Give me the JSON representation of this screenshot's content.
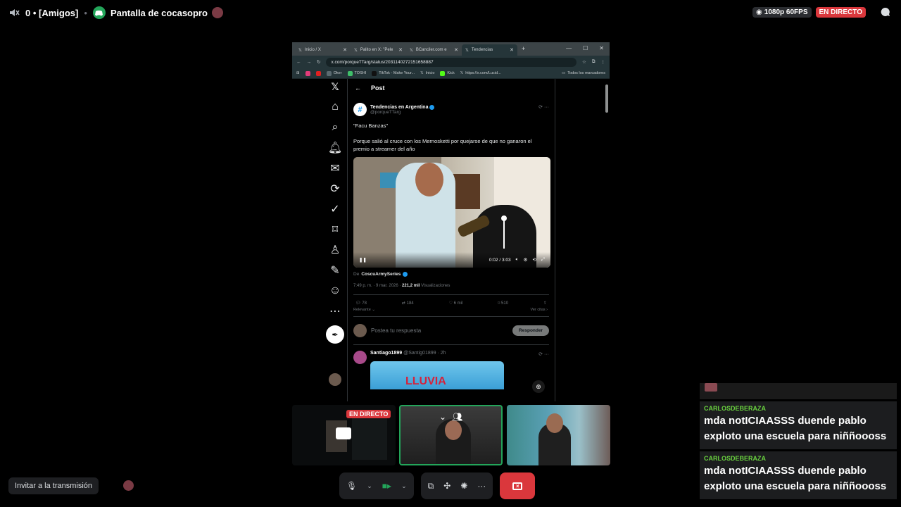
{
  "discord": {
    "server_label": "[Amigos]",
    "server_prefix": "0 •",
    "title": "Pantalla de cocasopro",
    "quality": "1080p 60FPS",
    "live_badge": "EN DIRECTO"
  },
  "browser": {
    "tabs": [
      {
        "label": "Inicio / X"
      },
      {
        "label": "Palito en X: \"Pele"
      },
      {
        "label": "BCanciler.com e"
      },
      {
        "label": "Tendencias"
      }
    ],
    "url": "x.com/porqueTTarg/status/2031140272151658887",
    "bookmarks": [
      "Oker",
      "TOSHI",
      "TikTok - Make Your...",
      "Inicio",
      "Kick",
      "https://x.com/Lucid..."
    ],
    "bookmarks_all": "Todos los marcadores"
  },
  "x": {
    "header": "Post",
    "author_name": "Tendencias en Argentina",
    "author_handle": "@porqueTTarg",
    "text": "\"Facu Banzas\"\n\nPorque salió al cruce con los Mernosketti por quejarse de que no ganaron el premio a streamer del año",
    "video_time": "0:02 / 3:03",
    "from_prefix": "De",
    "from_name": "CoscuArmySeries",
    "meta_time": "7:49 p. m. · 9 mar. 2026 ·",
    "views_count": "221,2 mil",
    "views_label": "Visualizaciones",
    "replies": "78",
    "reposts": "184",
    "likes": "6 mil",
    "bookmarks": "510",
    "sort_label": "Relevante",
    "quotes_label": "Ver citas",
    "reply_placeholder": "Postea tu respuesta",
    "reply_button": "Responder",
    "comment_name": "Santiago1899",
    "comment_meta": "@Santig01899 · 2h",
    "comment_image_text": "LLUVIA"
  },
  "thumbs": {
    "live_label": "EN DIRECTO"
  },
  "invite_label": "Invitar a la transmisión",
  "chat": [
    {
      "user": "CARLOSDEBERAZA",
      "text": "mda notICIAASSS duende pablo exploto una escuela para niññoooss"
    },
    {
      "user": "CARLOSDEBERAZA",
      "text": "mda notICIAASSS duende pablo exploto una escuela para niññoooss"
    }
  ],
  "colors": {
    "accent_green": "#23a55a",
    "live_red": "#da373c",
    "x_blue": "#1d9bf0",
    "chat_user": "#6ad13f"
  }
}
